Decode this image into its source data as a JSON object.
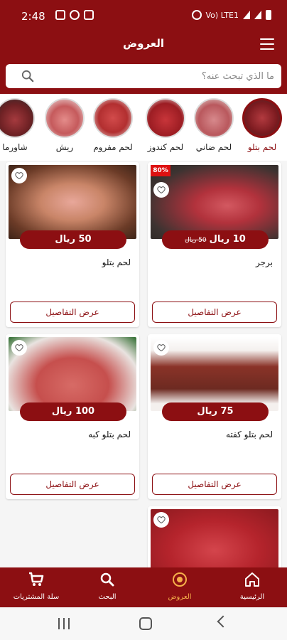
{
  "status_bar": {
    "time": "2:48",
    "network_label": "Vo) LTE1"
  },
  "app_bar": {
    "title": "العروض"
  },
  "search": {
    "placeholder": "ما الذي تبحث عنه؟"
  },
  "categories": [
    {
      "label": "لحم بتلو",
      "active": true
    },
    {
      "label": "لحم ضاني",
      "active": false
    },
    {
      "label": "لحم كندوز",
      "active": false
    },
    {
      "label": "لحم مفروم",
      "active": false
    },
    {
      "label": "ريش",
      "active": false
    },
    {
      "label": "شاورما",
      "active": false
    }
  ],
  "products": [
    {
      "name": "برجر",
      "price": "10 ريال",
      "old_price": "50 ريال",
      "discount": "80%",
      "details_label": "عرض التفاصيل"
    },
    {
      "name": "لحم بتلو",
      "price": "50 ريال",
      "details_label": "عرض التفاصيل"
    },
    {
      "name": "لحم بتلو كفته",
      "price": "75 ريال",
      "details_label": "عرض التفاصيل"
    },
    {
      "name": "لحم بتلو كبه",
      "price": "100 ريال",
      "details_label": "عرض التفاصيل"
    }
  ],
  "bottom_nav": [
    {
      "label": "الرئيسية",
      "icon": "home-icon"
    },
    {
      "label": "العروض",
      "icon": "offers-icon",
      "active": true
    },
    {
      "label": "البحث",
      "icon": "search-icon"
    },
    {
      "label": "سلة المشتريات",
      "icon": "cart-icon"
    }
  ],
  "colors": {
    "primary": "#8c0f12",
    "active_nav": "#f6b04a"
  }
}
